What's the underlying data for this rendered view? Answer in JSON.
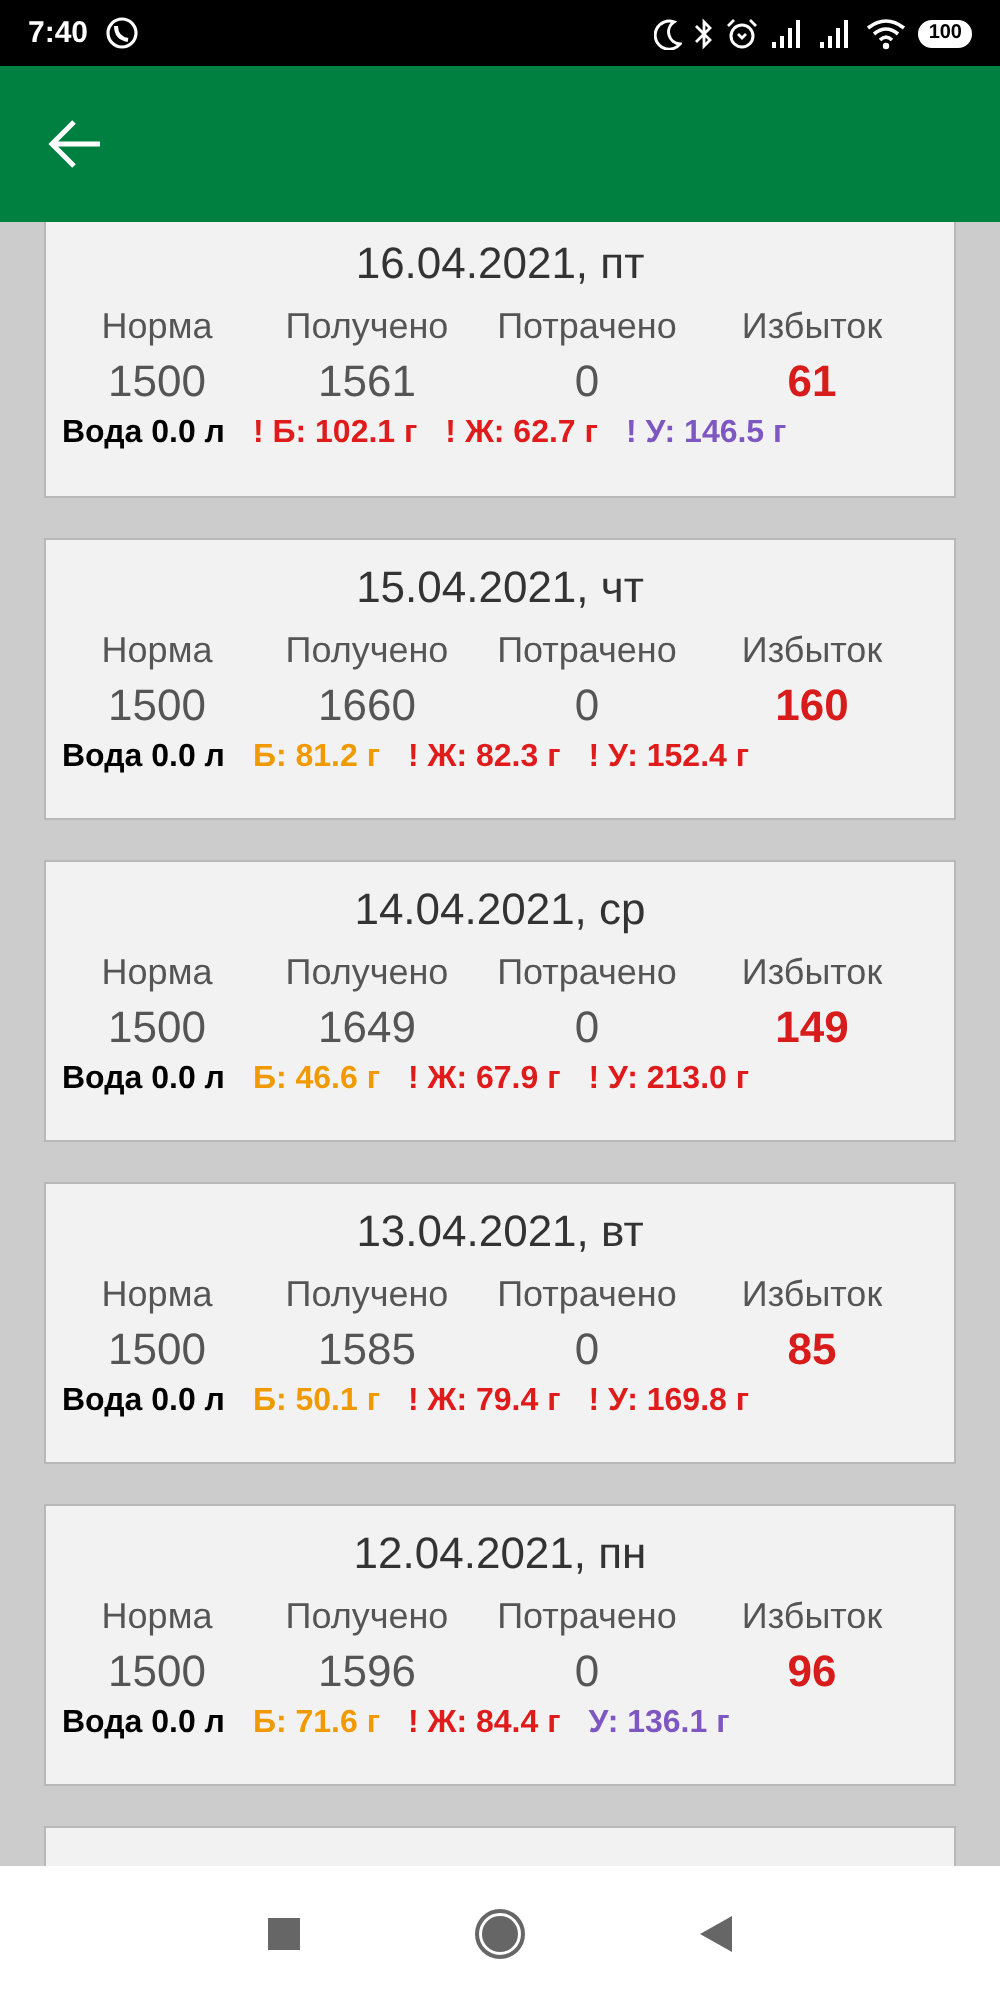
{
  "status_bar": {
    "time": "7:40",
    "battery": "100"
  },
  "days": [
    {
      "date": "16.04.2021, пт",
      "labels": [
        "Норма",
        "Получено",
        "Потрачено",
        "Избыток"
      ],
      "norm": "1500",
      "received": "1561",
      "spent": "0",
      "excess": "61",
      "water": "Вода 0.0 л",
      "macros": [
        {
          "text": "! Б: 102.1 г",
          "color": "#e01b1b"
        },
        {
          "text": "! Ж: 62.7 г",
          "color": "#e01b1b"
        },
        {
          "text": "! У: 146.5 г",
          "color": "#7e57c2"
        }
      ]
    },
    {
      "date": "15.04.2021, чт",
      "labels": [
        "Норма",
        "Получено",
        "Потрачено",
        "Избыток"
      ],
      "norm": "1500",
      "received": "1660",
      "spent": "0",
      "excess": "160",
      "water": "Вода 0.0 л",
      "macros": [
        {
          "text": "Б: 81.2 г",
          "color": "#f09a00"
        },
        {
          "text": "! Ж: 82.3 г",
          "color": "#e01b1b"
        },
        {
          "text": "! У: 152.4 г",
          "color": "#e01b1b"
        }
      ]
    },
    {
      "date": "14.04.2021, ср",
      "labels": [
        "Норма",
        "Получено",
        "Потрачено",
        "Избыток"
      ],
      "norm": "1500",
      "received": "1649",
      "spent": "0",
      "excess": "149",
      "water": "Вода 0.0 л",
      "macros": [
        {
          "text": "Б: 46.6 г",
          "color": "#f09a00"
        },
        {
          "text": "! Ж: 67.9 г",
          "color": "#e01b1b"
        },
        {
          "text": "! У: 213.0 г",
          "color": "#e01b1b"
        }
      ]
    },
    {
      "date": "13.04.2021, вт",
      "labels": [
        "Норма",
        "Получено",
        "Потрачено",
        "Избыток"
      ],
      "norm": "1500",
      "received": "1585",
      "spent": "0",
      "excess": "85",
      "water": "Вода 0.0 л",
      "macros": [
        {
          "text": "Б: 50.1 г",
          "color": "#f09a00"
        },
        {
          "text": "! Ж: 79.4 г",
          "color": "#e01b1b"
        },
        {
          "text": "! У: 169.8 г",
          "color": "#e01b1b"
        }
      ]
    },
    {
      "date": "12.04.2021, пн",
      "labels": [
        "Норма",
        "Получено",
        "Потрачено",
        "Избыток"
      ],
      "norm": "1500",
      "received": "1596",
      "spent": "0",
      "excess": "96",
      "water": "Вода 0.0 л",
      "macros": [
        {
          "text": "Б: 71.6 г",
          "color": "#f09a00"
        },
        {
          "text": "! Ж: 84.4 г",
          "color": "#e01b1b"
        },
        {
          "text": "У: 136.1 г",
          "color": "#7e57c2"
        }
      ]
    }
  ]
}
